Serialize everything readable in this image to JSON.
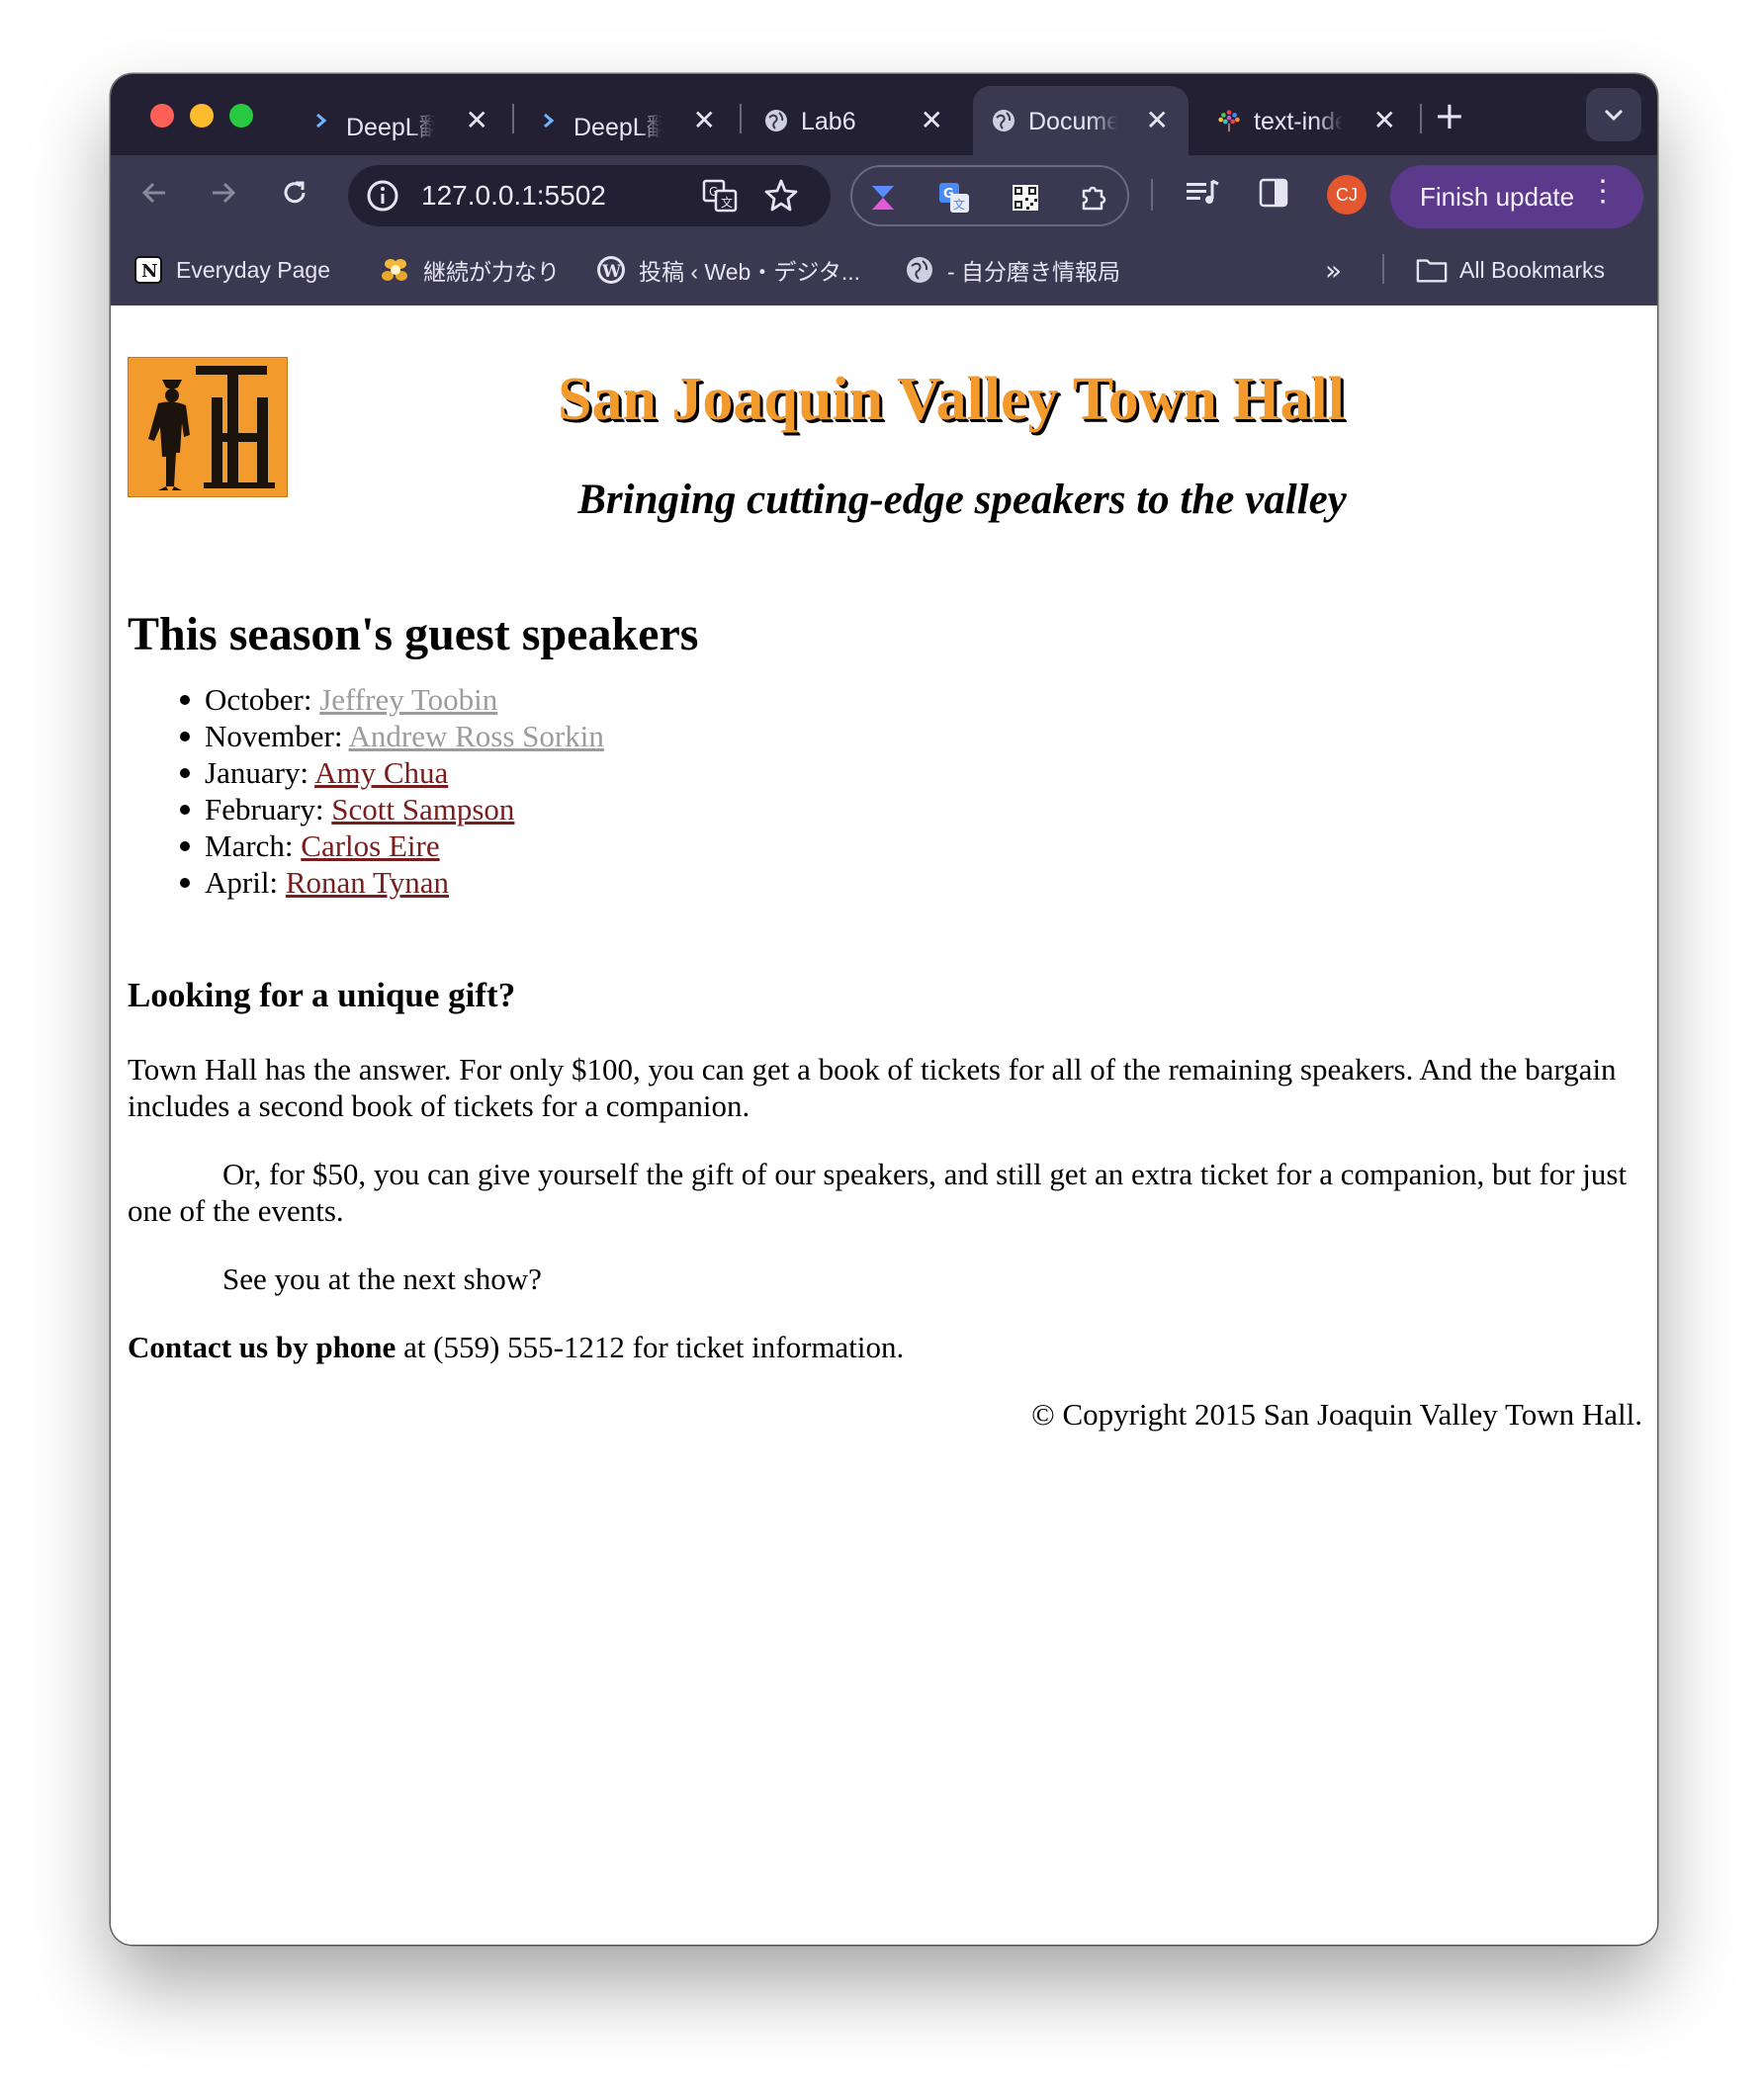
{
  "browser": {
    "tabs": [
      {
        "label": "DeepL翻訳",
        "icon": "deepl-icon",
        "active": false
      },
      {
        "label": "DeepL翻訳",
        "icon": "deepl-icon",
        "active": false
      },
      {
        "label": "Lab6",
        "icon": "globe-icon",
        "active": false
      },
      {
        "label": "Document",
        "icon": "globe-icon",
        "active": true
      },
      {
        "label": "text-indent",
        "icon": "tree-icon",
        "active": false
      }
    ],
    "address": "127.0.0.1:5502",
    "finish_update": "Finish update",
    "avatar": "CJ",
    "bookmarks": [
      {
        "label": "Everyday Page",
        "icon": "notion-icon"
      },
      {
        "label": "継続が力なり",
        "icon": "bees-icon"
      },
      {
        "label": "投稿 ‹ Web・デジタ...",
        "icon": "wordpress-icon"
      },
      {
        "label": "- 自分磨き情報局",
        "icon": "globe-icon"
      }
    ],
    "all_bookmarks": "All Bookmarks"
  },
  "page": {
    "site_title": "San Joaquin Valley Town Hall",
    "tagline": "Bringing cutting-edge speakers to the valley",
    "speakers_heading": "This season's guest speakers",
    "speakers": [
      {
        "month": "October:",
        "name": "Jeffrey Toobin",
        "visited": true
      },
      {
        "month": "November:",
        "name": "Andrew Ross Sorkin",
        "visited": true
      },
      {
        "month": "January:",
        "name": "Amy Chua",
        "visited": false
      },
      {
        "month": "February:",
        "name": "Scott Sampson",
        "visited": false
      },
      {
        "month": "March:",
        "name": "Carlos Eire",
        "visited": false
      },
      {
        "month": "April:",
        "name": "Ronan Tynan",
        "visited": false
      }
    ],
    "gift_heading": "Looking for a unique gift?",
    "para1": "Town Hall has the answer. For only $100, you can get a book of tickets for all of the remaining speakers. And the bargain includes a second book of tickets for a companion.",
    "para2": "Or, for $50, you can give yourself the gift of our speakers, and still get an extra ticket for a companion, but for just one of the events.",
    "para3": "See you at the next show?",
    "contact_bold": "Contact us by phone",
    "contact_rest": " at (559) 555-1212 for ticket information.",
    "copyright": "© Copyright 2015 San Joaquin Valley Town Hall."
  }
}
